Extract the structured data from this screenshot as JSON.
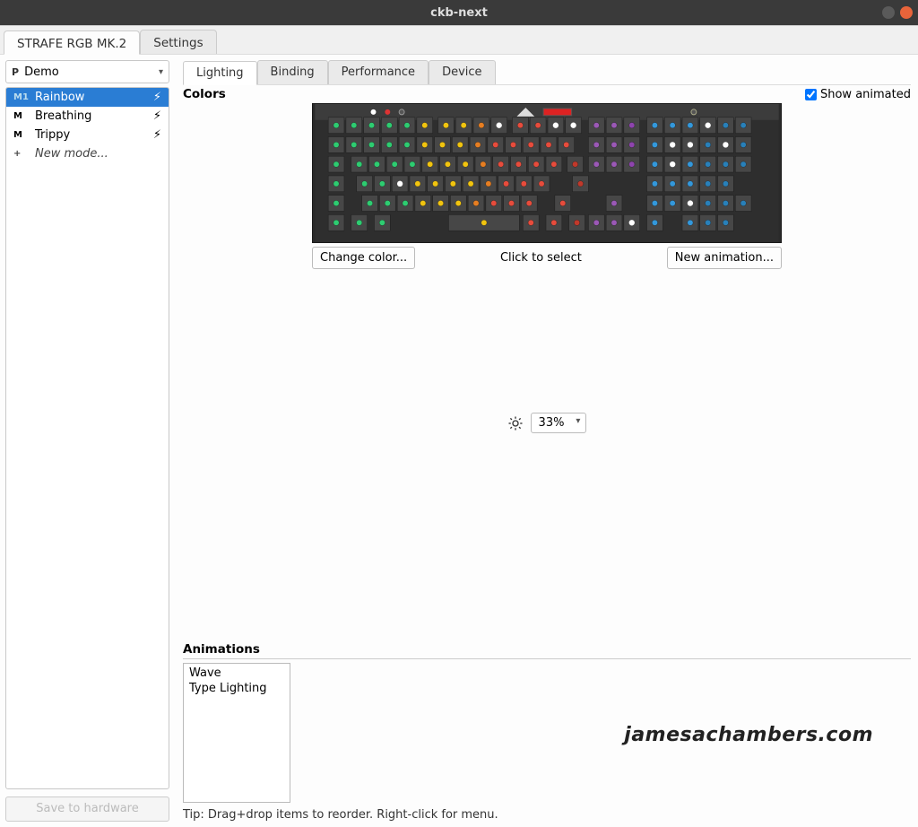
{
  "window": {
    "title": "ckb-next"
  },
  "outer_tabs": {
    "device": "STRAFE RGB MK.2",
    "settings": "Settings"
  },
  "profile": {
    "marker": "P",
    "name": "Demo"
  },
  "modes": {
    "items": [
      {
        "icon": "M1",
        "label": "Rainbow",
        "flash": true
      },
      {
        "icon": "M",
        "label": "Breathing",
        "flash": true
      },
      {
        "icon": "M",
        "label": "Trippy",
        "flash": true
      }
    ],
    "new_mode_label": "New mode...",
    "new_mode_icon": "+"
  },
  "save_hw": "Save to hardware",
  "inner_tabs": {
    "lighting": "Lighting",
    "binding": "Binding",
    "performance": "Performance",
    "device": "Device"
  },
  "colors": {
    "heading": "Colors",
    "show_animated": "Show animated",
    "change_color": "Change color...",
    "click_select": "Click to select",
    "new_animation": "New animation..."
  },
  "brightness": {
    "value": "33%"
  },
  "animations": {
    "heading": "Animations",
    "items": [
      "Wave",
      "Type Lighting"
    ],
    "tip": "Tip: Drag+drop items to reorder. Right-click for menu."
  },
  "watermark": "jamesachambers.com"
}
